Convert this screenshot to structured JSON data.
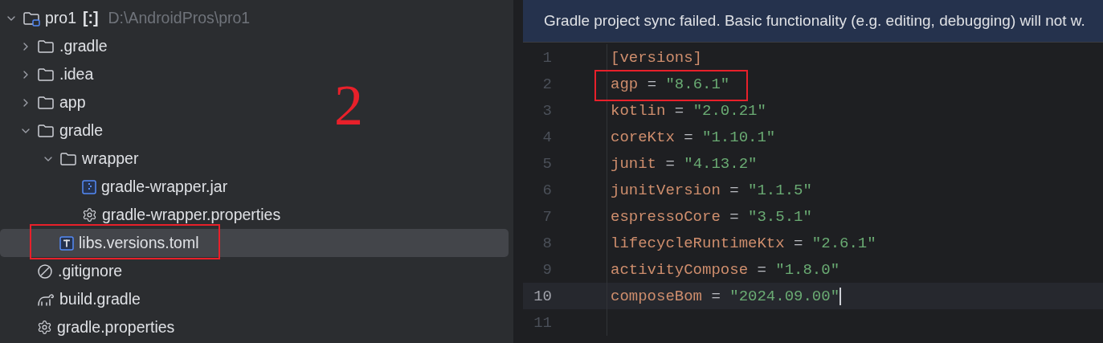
{
  "project_tree": [
    {
      "kind": "project",
      "name": "pro1",
      "badge": "[:]",
      "path": "D:\\AndroidPros\\pro1",
      "expanded": true,
      "selected": false,
      "children": [
        {
          "kind": "folder",
          "name": ".gradle",
          "expanded": false,
          "selected": false
        },
        {
          "kind": "folder",
          "name": ".idea",
          "expanded": false,
          "selected": false
        },
        {
          "kind": "folder",
          "name": "app",
          "expanded": false,
          "selected": false
        },
        {
          "kind": "folder",
          "name": "gradle",
          "expanded": true,
          "selected": false,
          "children": [
            {
              "kind": "folder",
              "name": "wrapper",
              "expanded": true,
              "selected": false,
              "children": [
                {
                  "kind": "jar",
                  "name": "gradle-wrapper.jar",
                  "selected": false
                },
                {
                  "kind": "settings",
                  "name": "gradle-wrapper.properties",
                  "selected": false
                }
              ]
            },
            {
              "kind": "toml",
              "name": "libs.versions.toml",
              "selected": true
            }
          ]
        },
        {
          "kind": "ignore",
          "name": ".gitignore",
          "selected": false
        },
        {
          "kind": "gradle",
          "name": "build.gradle",
          "selected": false
        },
        {
          "kind": "settings",
          "name": "gradle.properties",
          "selected": false
        }
      ]
    }
  ],
  "banner": {
    "text": "Gradle project sync failed. Basic functionality (e.g. editing, debugging) will not w."
  },
  "editor": {
    "lines": [
      {
        "number": "1",
        "kind": "section",
        "text": "[versions]",
        "current": false
      },
      {
        "number": "2",
        "kind": "pair",
        "key": "agp",
        "operator": "=",
        "value": "\"8.6.1\"",
        "current": false
      },
      {
        "number": "3",
        "kind": "pair",
        "key": "kotlin",
        "operator": "=",
        "value": "\"2.0.21\"",
        "current": false
      },
      {
        "number": "4",
        "kind": "pair",
        "key": "coreKtx",
        "operator": "=",
        "value": "\"1.10.1\"",
        "current": false
      },
      {
        "number": "5",
        "kind": "pair",
        "key": "junit",
        "operator": "=",
        "value": "\"4.13.2\"",
        "current": false
      },
      {
        "number": "6",
        "kind": "pair",
        "key": "junitVersion",
        "operator": "=",
        "value": "\"1.1.5\"",
        "current": false
      },
      {
        "number": "7",
        "kind": "pair",
        "key": "espressoCore",
        "operator": "=",
        "value": "\"3.5.1\"",
        "current": false
      },
      {
        "number": "8",
        "kind": "pair",
        "key": "lifecycleRuntimeKtx",
        "operator": "=",
        "value": "\"2.6.1\"",
        "current": false
      },
      {
        "number": "9",
        "kind": "pair",
        "key": "activityCompose",
        "operator": "=",
        "value": "\"1.8.0\"",
        "current": false
      },
      {
        "number": "10",
        "kind": "pair",
        "key": "composeBom",
        "operator": "=",
        "value": "\"2024.09.00\"",
        "current": true
      },
      {
        "number": "11",
        "kind": "blank",
        "current": false
      }
    ]
  },
  "annotations": {
    "label": "2"
  }
}
